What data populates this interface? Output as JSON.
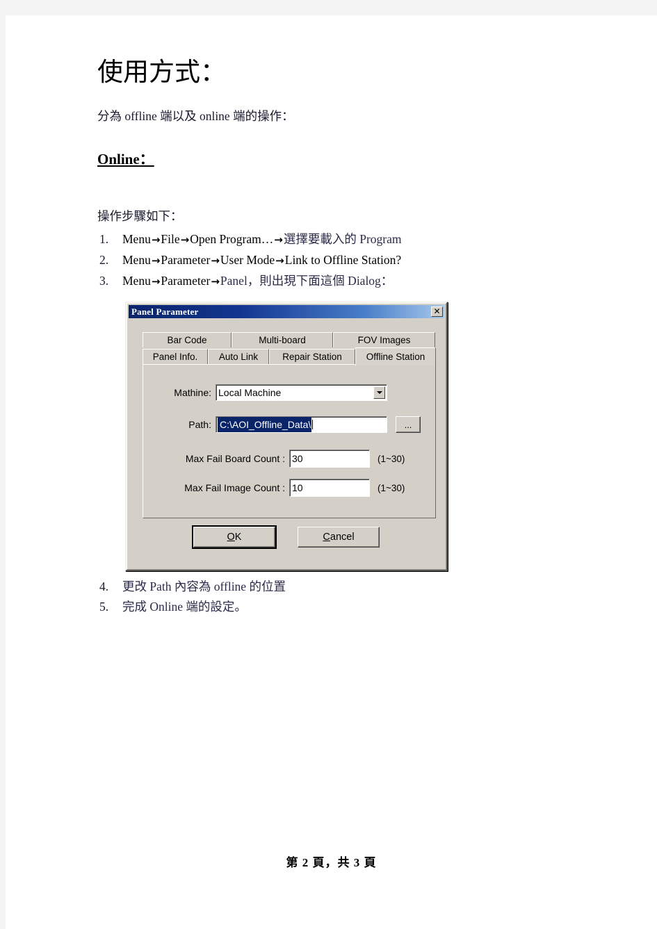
{
  "document": {
    "heading": "使用方式：",
    "intro": "分為 offline 端以及 online 端的操作：",
    "section_heading": "Online：",
    "steps_lead": "操作步驟如下：",
    "steps": [
      {
        "num": "1.",
        "parts": [
          "Menu",
          "→",
          "File",
          "→",
          "Open  Program…",
          "→",
          "選擇要載入的 Program"
        ]
      },
      {
        "num": "2.",
        "parts": [
          "Menu",
          "→",
          "Parameter",
          "→",
          "User  Mode",
          "→",
          "Link  to  Offline  Station?"
        ]
      },
      {
        "num": "3.",
        "parts": [
          "Menu",
          "→",
          "Parameter",
          "→",
          "Panel，則出現下面這個 Dialog："
        ]
      }
    ],
    "steps_after": [
      {
        "num": "4.",
        "text": "更改 Path 內容為 offline 的位置"
      },
      {
        "num": "5.",
        "text": "完成 Online 端的設定。"
      }
    ],
    "footer": "第 2 頁，共 3 頁"
  },
  "dialog": {
    "title": "Panel Parameter",
    "close_label": "✕",
    "tabs_row1": [
      {
        "label": "Bar Code",
        "selected": false
      },
      {
        "label": "Multi-board",
        "selected": false
      },
      {
        "label": "FOV Images",
        "selected": false
      }
    ],
    "tabs_row2": [
      {
        "label": "Panel Info.",
        "selected": false
      },
      {
        "label": "Auto Link",
        "selected": false
      },
      {
        "label": "Repair Station",
        "selected": false
      },
      {
        "label": "Offline Station",
        "selected": true
      }
    ],
    "fields": {
      "machine_label": "Mathine:",
      "machine_value": "Local Machine",
      "path_label": "Path:",
      "path_value": "C:\\AOI_Offline_Data\\",
      "browse_label": "...",
      "max_fail_board_label": "Max Fail Board Count :",
      "max_fail_board_value": "30",
      "max_fail_board_hint": "(1~30)",
      "max_fail_image_label": "Max Fail Image Count :",
      "max_fail_image_value": "10",
      "max_fail_image_hint": "(1~30)"
    },
    "buttons": {
      "ok_accel": "O",
      "ok_rest": "K",
      "cancel_accel": "C",
      "cancel_rest": "ancel"
    },
    "colors": {
      "face": "#d4d0c8",
      "title_start": "#0a246a",
      "title_end": "#a6c8ec",
      "selection": "#0a246a"
    }
  }
}
